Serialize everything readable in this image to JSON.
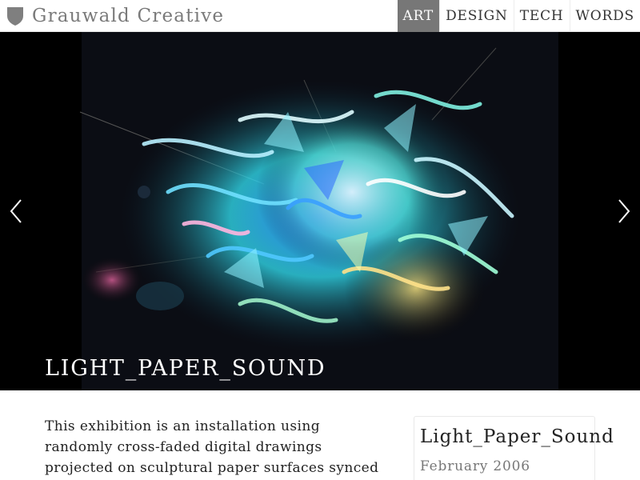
{
  "header": {
    "brand_name": "Grauwald Creative",
    "logo_icon": "shield-icon",
    "nav": [
      {
        "label": "ART",
        "active": true
      },
      {
        "label": "DESIGN",
        "active": false
      },
      {
        "label": "TECH",
        "active": false
      },
      {
        "label": "WORDS",
        "active": false
      }
    ]
  },
  "hero": {
    "title": "LIGHT_PAPER_SOUND",
    "prev_icon": "chevron-left-icon",
    "next_icon": "chevron-right-icon"
  },
  "content": {
    "description": "This exhibition is an installation using randomly cross-faded digital drawings projected on sculptural paper surfaces synced",
    "card": {
      "title": "Light_Paper_Sound",
      "date": "February 2006"
    }
  },
  "colors": {
    "nav_active_bg": "#777777",
    "brand_gray": "#7a7a7a",
    "hero_bg": "#000000"
  }
}
